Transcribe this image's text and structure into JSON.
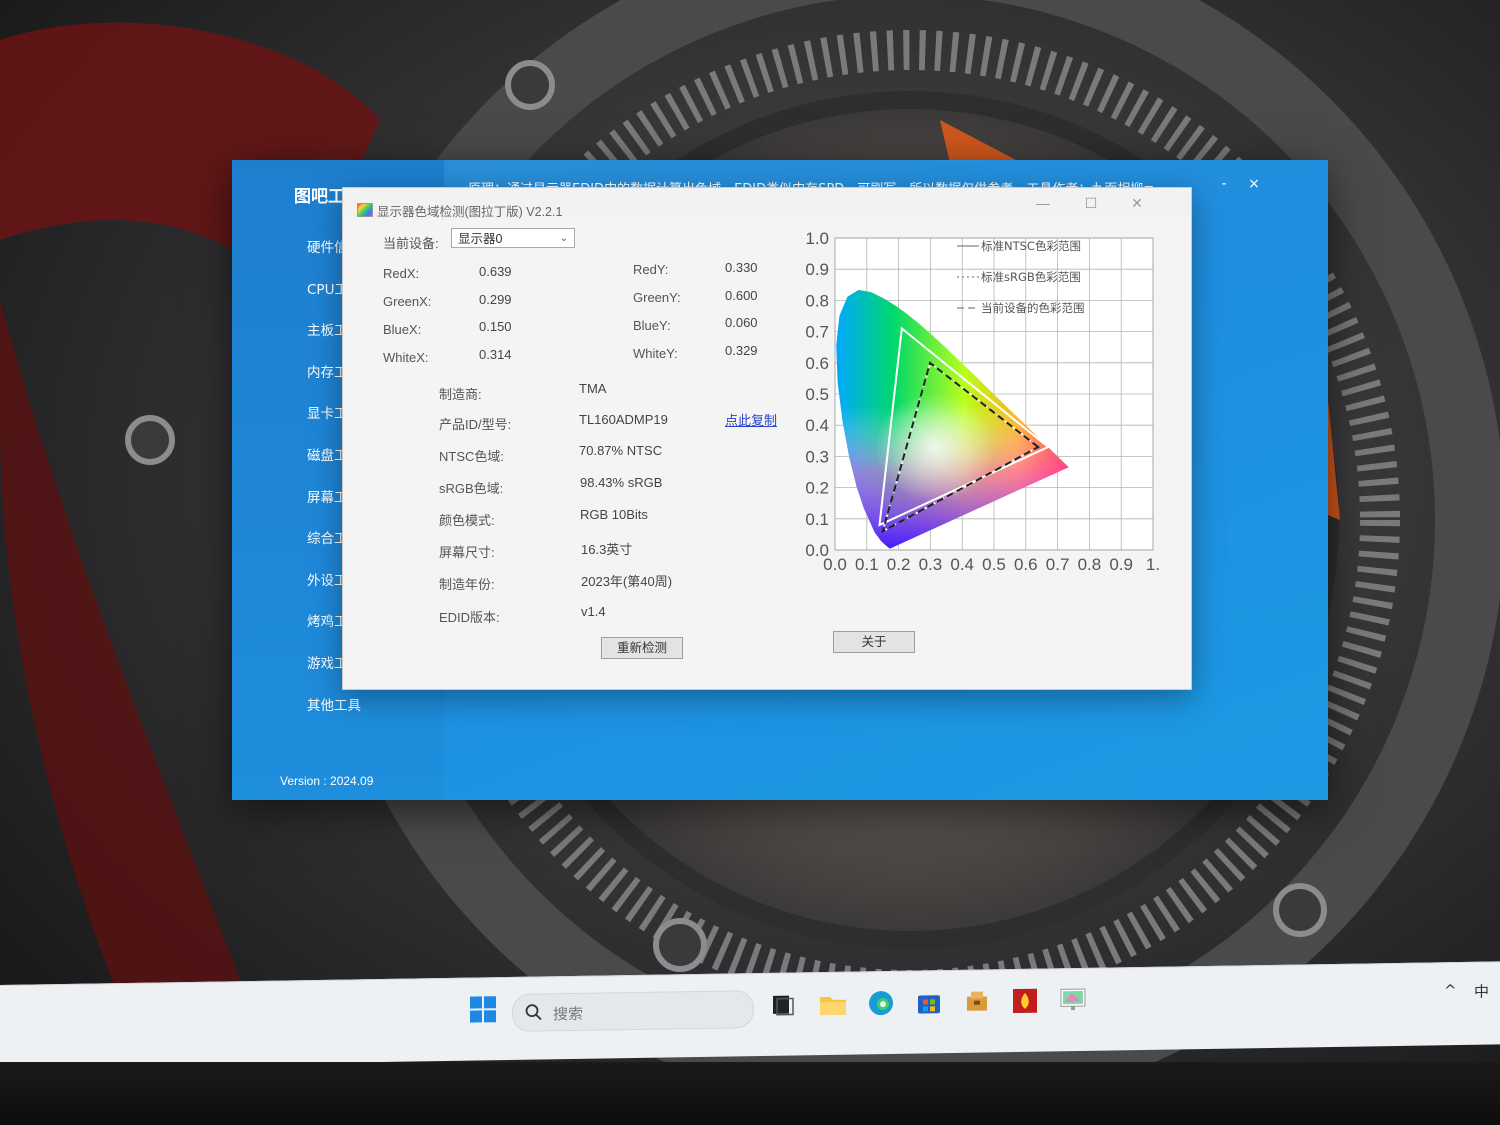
{
  "toolbox": {
    "title": "图吧工具箱",
    "banner": "原理：通过显示器EDID中的数据计算出色域，EDID类似内存SPD，可刷写，所以数据仅供参考。工具作者：九面相柳≡",
    "menu": [
      "硬件信",
      "CPU工",
      "主板工",
      "内存工",
      "显卡工",
      "磁盘工",
      "屏幕工",
      "综合工",
      "外设工",
      "烤鸡工",
      "游戏工",
      "其他工具"
    ],
    "version": "Version : 2024.09",
    "minimize": "-",
    "close": "×"
  },
  "gamut": {
    "title": "显示器色域检测(图拉丁版) V2.2.1",
    "controls": {
      "minimize": "—",
      "maximize": "☐",
      "close": "✕"
    },
    "device_label": "当前设备:",
    "device_value": "显示器0",
    "coords": {
      "RedX_label": "RedX:",
      "RedX": "0.639",
      "GreenX_label": "GreenX:",
      "GreenX": "0.299",
      "BlueX_label": "BlueX:",
      "BlueX": "0.150",
      "WhiteX_label": "WhiteX:",
      "WhiteX": "0.314",
      "RedY_label": "RedY:",
      "RedY": "0.330",
      "GreenY_label": "GreenY:",
      "GreenY": "0.600",
      "BlueY_label": "BlueY:",
      "BlueY": "0.060",
      "WhiteY_label": "WhiteY:",
      "WhiteY": "0.329"
    },
    "info": [
      {
        "label": "制造商:",
        "value": "TMA"
      },
      {
        "label": "产品ID/型号:",
        "value": "TL160ADMP19"
      },
      {
        "label": "NTSC色域:",
        "value": "70.87% NTSC"
      },
      {
        "label": "sRGB色域:",
        "value": "98.43% sRGB"
      },
      {
        "label": "颜色模式:",
        "value": "RGB 10Bits"
      },
      {
        "label": "屏幕尺寸:",
        "value": "16.3英寸"
      },
      {
        "label": "制造年份:",
        "value": "2023年(第40周)"
      },
      {
        "label": "EDID版本:",
        "value": "v1.4"
      }
    ],
    "copy_link": "点此复制",
    "recheck_button": "重新检测",
    "about_button": "关于"
  },
  "chart_data": {
    "type": "scatter",
    "title": "",
    "xlabel": "",
    "ylabel": "",
    "xlim": [
      0,
      1
    ],
    "ylim": [
      0,
      1
    ],
    "x_ticks": [
      "0.0",
      "0.1",
      "0.2",
      "0.3",
      "0.4",
      "0.5",
      "0.6",
      "0.7",
      "0.8",
      "0.9",
      "1."
    ],
    "y_ticks": [
      "0.0",
      "0.1",
      "0.2",
      "0.3",
      "0.4",
      "0.5",
      "0.6",
      "0.7",
      "0.8",
      "0.9",
      "1.0"
    ],
    "grid": true,
    "legend_position": "top-right",
    "series": [
      {
        "name": "标准NTSC色彩范围",
        "style": "solid",
        "color": "#ffffff",
        "points": [
          [
            0.67,
            0.33
          ],
          [
            0.21,
            0.71
          ],
          [
            0.14,
            0.08
          ]
        ]
      },
      {
        "name": "标准sRGB色彩范围",
        "style": "dotted",
        "color": "#ffffff",
        "points": [
          [
            0.64,
            0.33
          ],
          [
            0.3,
            0.6
          ],
          [
            0.15,
            0.06
          ]
        ]
      },
      {
        "name": "当前设备的色彩范围",
        "style": "dashed",
        "color": "#222222",
        "points": [
          [
            0.639,
            0.33
          ],
          [
            0.299,
            0.6
          ],
          [
            0.15,
            0.06
          ]
        ]
      }
    ],
    "white_point": [
      0.314,
      0.329
    ]
  },
  "taskbar": {
    "search_placeholder": "搜索",
    "tray_chevron": "^",
    "ime": "中"
  }
}
